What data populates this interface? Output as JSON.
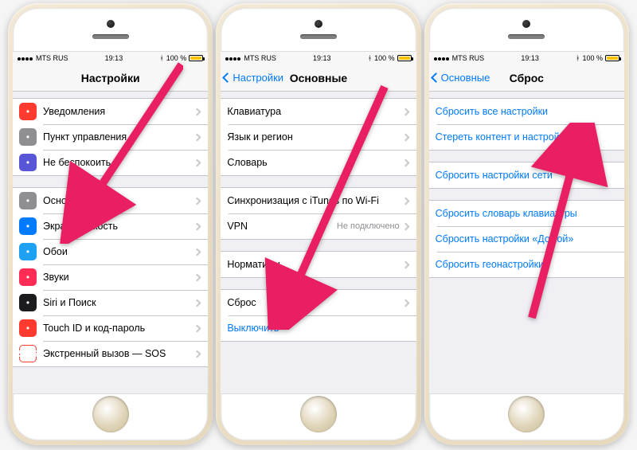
{
  "status": {
    "carrier": "MTS RUS",
    "time": "19:13",
    "battery": "100 %"
  },
  "phone1": {
    "title": "Настройки",
    "g1": [
      {
        "label": "Уведомления",
        "icon": "notification-icon",
        "cls": "ic-notif"
      },
      {
        "label": "Пункт управления",
        "icon": "control-center-icon",
        "cls": "ic-gray"
      },
      {
        "label": "Не беспокоить",
        "icon": "do-not-disturb-icon",
        "cls": "ic-purple"
      }
    ],
    "g2": [
      {
        "label": "Основные",
        "icon": "general-icon",
        "cls": "ic-gray"
      },
      {
        "label": "Экран и яркость",
        "icon": "display-icon",
        "cls": "ic-blue"
      },
      {
        "label": "Обои",
        "icon": "wallpaper-icon",
        "cls": "ic-cyan"
      },
      {
        "label": "Звуки",
        "icon": "sounds-icon",
        "cls": "ic-pink"
      },
      {
        "label": "Siri и Поиск",
        "icon": "siri-icon",
        "cls": "ic-dark"
      },
      {
        "label": "Touch ID и код-пароль",
        "icon": "touchid-icon",
        "cls": "ic-red"
      },
      {
        "label": "Экстренный вызов — SOS",
        "icon": "sos-icon",
        "cls": "ic-sos"
      }
    ]
  },
  "phone2": {
    "back": "Настройки",
    "title": "Основные",
    "g1": [
      {
        "label": "Клавиатура"
      },
      {
        "label": "Язык и регион"
      },
      {
        "label": "Словарь"
      }
    ],
    "g2": [
      {
        "label": "Синхронизация с iTunes по Wi-Fi"
      },
      {
        "label": "VPN",
        "detail": "Не подключено"
      }
    ],
    "g3": [
      {
        "label": "Нормативы"
      }
    ],
    "g4": [
      {
        "label": "Сброс"
      },
      {
        "label": "Выключить",
        "link": true,
        "noChevron": true
      }
    ]
  },
  "phone3": {
    "back": "Основные",
    "title": "Сброс",
    "g1": [
      {
        "label": "Сбросить все настройки",
        "link": true
      },
      {
        "label": "Стереть контент и настройки",
        "link": true
      }
    ],
    "g2": [
      {
        "label": "Сбросить настройки сети",
        "link": true
      }
    ],
    "g3": [
      {
        "label": "Сбросить словарь клавиатуры",
        "link": true
      },
      {
        "label": "Сбросить настройки «Домой»",
        "link": true
      },
      {
        "label": "Сбросить геонастройки",
        "link": true
      }
    ]
  }
}
